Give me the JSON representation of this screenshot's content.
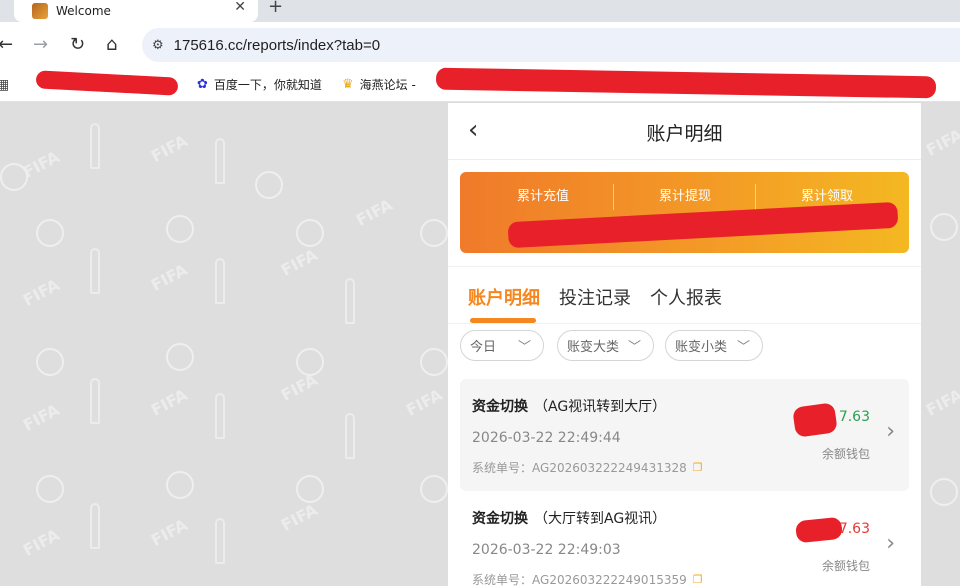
{
  "browser": {
    "tab_title": "Welcome",
    "tab_close": "✕",
    "new_tab": "+",
    "url": "175616.cc/reports/index?tab=0",
    "bookmarks": [
      {
        "label": "百度一下，你就知道",
        "icon": "baidu-paw-icon"
      },
      {
        "label": "海燕论坛 -",
        "icon": "trophy-icon"
      }
    ]
  },
  "pattern": {
    "text": "FIFA"
  },
  "page": {
    "title": "账户明细",
    "summary": {
      "items": [
        {
          "label": "累计充值"
        },
        {
          "label": "累计提现"
        },
        {
          "label": "累计领取"
        }
      ]
    },
    "tabs": [
      {
        "label": "账户明细",
        "active": true
      },
      {
        "label": "投注记录",
        "active": false
      },
      {
        "label": "个人报表",
        "active": false
      }
    ],
    "filters": [
      {
        "value": "今日"
      },
      {
        "value": "账变大类"
      },
      {
        "value": "账变小类"
      }
    ],
    "records": [
      {
        "type": "资金切换",
        "detail": "（AG视讯转到大厅）",
        "time": "2026-03-22 22:49:44",
        "order_label": "系统单号：",
        "order_no": "AG202603222249431328",
        "amount_visible": "7.63",
        "amount_color": "#2aa14f",
        "wallet": "余额钱包"
      },
      {
        "type": "资金切换",
        "detail": "（大厅转到AG视讯）",
        "time": "2026-03-22 22:49:03",
        "order_label": "系统单号：",
        "order_no": "AG202603222249015359",
        "amount_visible": "7.63",
        "amount_color": "#e53935",
        "wallet": "余额钱包"
      }
    ]
  },
  "colors": {
    "accent": "#f5871f",
    "redaction": "#e8202a"
  }
}
